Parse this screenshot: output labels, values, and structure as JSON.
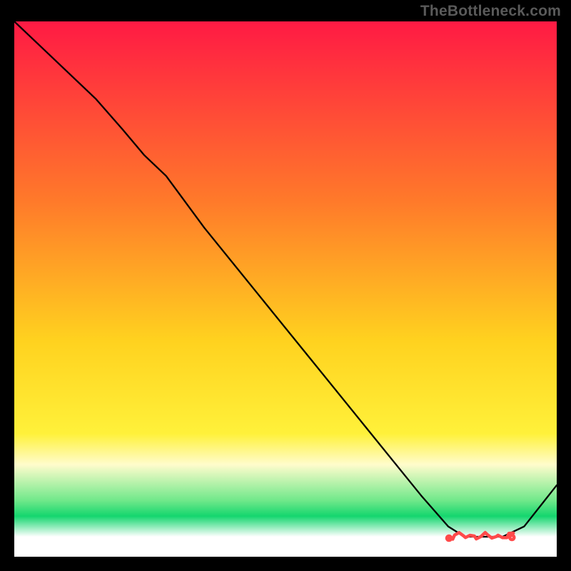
{
  "watermark": "TheBottleneck.com",
  "chart_data": {
    "type": "line",
    "title": "",
    "xlabel": "",
    "ylabel": "",
    "xlim": [
      0,
      100
    ],
    "ylim": [
      0,
      100
    ],
    "grid": false,
    "legend": false,
    "background_gradient": {
      "stops": [
        {
          "pos": 0,
          "color": "#ff1a44"
        },
        {
          "pos": 35,
          "color": "#ff7a2a"
        },
        {
          "pos": 62,
          "color": "#ffd21f"
        },
        {
          "pos": 80,
          "color": "#fff13a"
        },
        {
          "pos": 86,
          "color": "#fffccc"
        },
        {
          "pos": 93,
          "color": "#6fe88a"
        },
        {
          "pos": 96,
          "color": "#14d66e"
        },
        {
          "pos": 100,
          "color": "#ffffff"
        }
      ]
    },
    "series": [
      {
        "name": "bottleneck-curve",
        "color": "#000000",
        "x": [
          0,
          5,
          10,
          15,
          20,
          24,
          28,
          35,
          45,
          55,
          65,
          75,
          80,
          83,
          85,
          88,
          90,
          92,
          94,
          100
        ],
        "y": [
          100,
          95,
          90,
          85,
          79,
          74,
          70,
          60,
          47,
          34,
          21,
          8,
          2,
          0,
          0,
          0,
          0,
          1,
          2,
          10
        ]
      }
    ],
    "annotations": [
      {
        "name": "sweet-spot-marker",
        "shape": "scribble",
        "color": "#ff4a4a",
        "x_start": 80,
        "x_end": 92,
        "y": 0
      }
    ]
  }
}
